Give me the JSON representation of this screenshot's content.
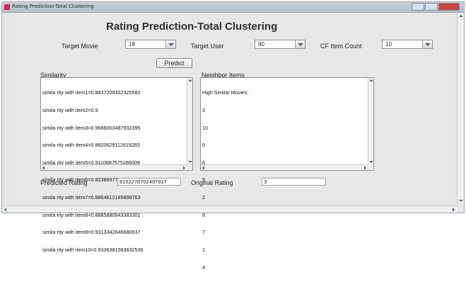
{
  "window": {
    "title": "Rating Prediction-Total Clustering"
  },
  "header": {
    "title": "Rating Prediction-Total Clustering"
  },
  "controls": {
    "target_movie_label": "Target Movie",
    "target_movie_value": "18",
    "target_user_label": "Target User",
    "target_user_value": "90",
    "cf_item_count_label": "CF Item Count",
    "cf_item_count_value": "10",
    "predict_button": "Predict"
  },
  "similarity": {
    "title": "Similarity",
    "lines": [
      "simila rity with item1=0.8837209302325582",
      "simila rity with item2=0.9",
      "simila rity with item3=0.9666003487932395",
      "simila rity with item4=0.8820629112619283",
      "simila rity with item5=0.9110887575286009",
      "simila rity with item6=0.9238697708743119",
      "simila rity with item7=0.8864612185898763",
      "simila rity with item8=0.8885880943383301",
      "simila rity with item9=0.9313342646680637",
      "simila rity with item10=0.9336381083632536"
    ]
  },
  "neighbors": {
    "title": "Neighbor Items",
    "lines": [
      "High Similar Movies:",
      "3",
      "10",
      "9",
      "6",
      "5",
      "2",
      "8",
      "7",
      "1",
      "4"
    ]
  },
  "results": {
    "predicted_label": "Predicted Rating",
    "predicted_value": "8152278702497937",
    "original_label": "Original Rating",
    "original_value": "3"
  }
}
